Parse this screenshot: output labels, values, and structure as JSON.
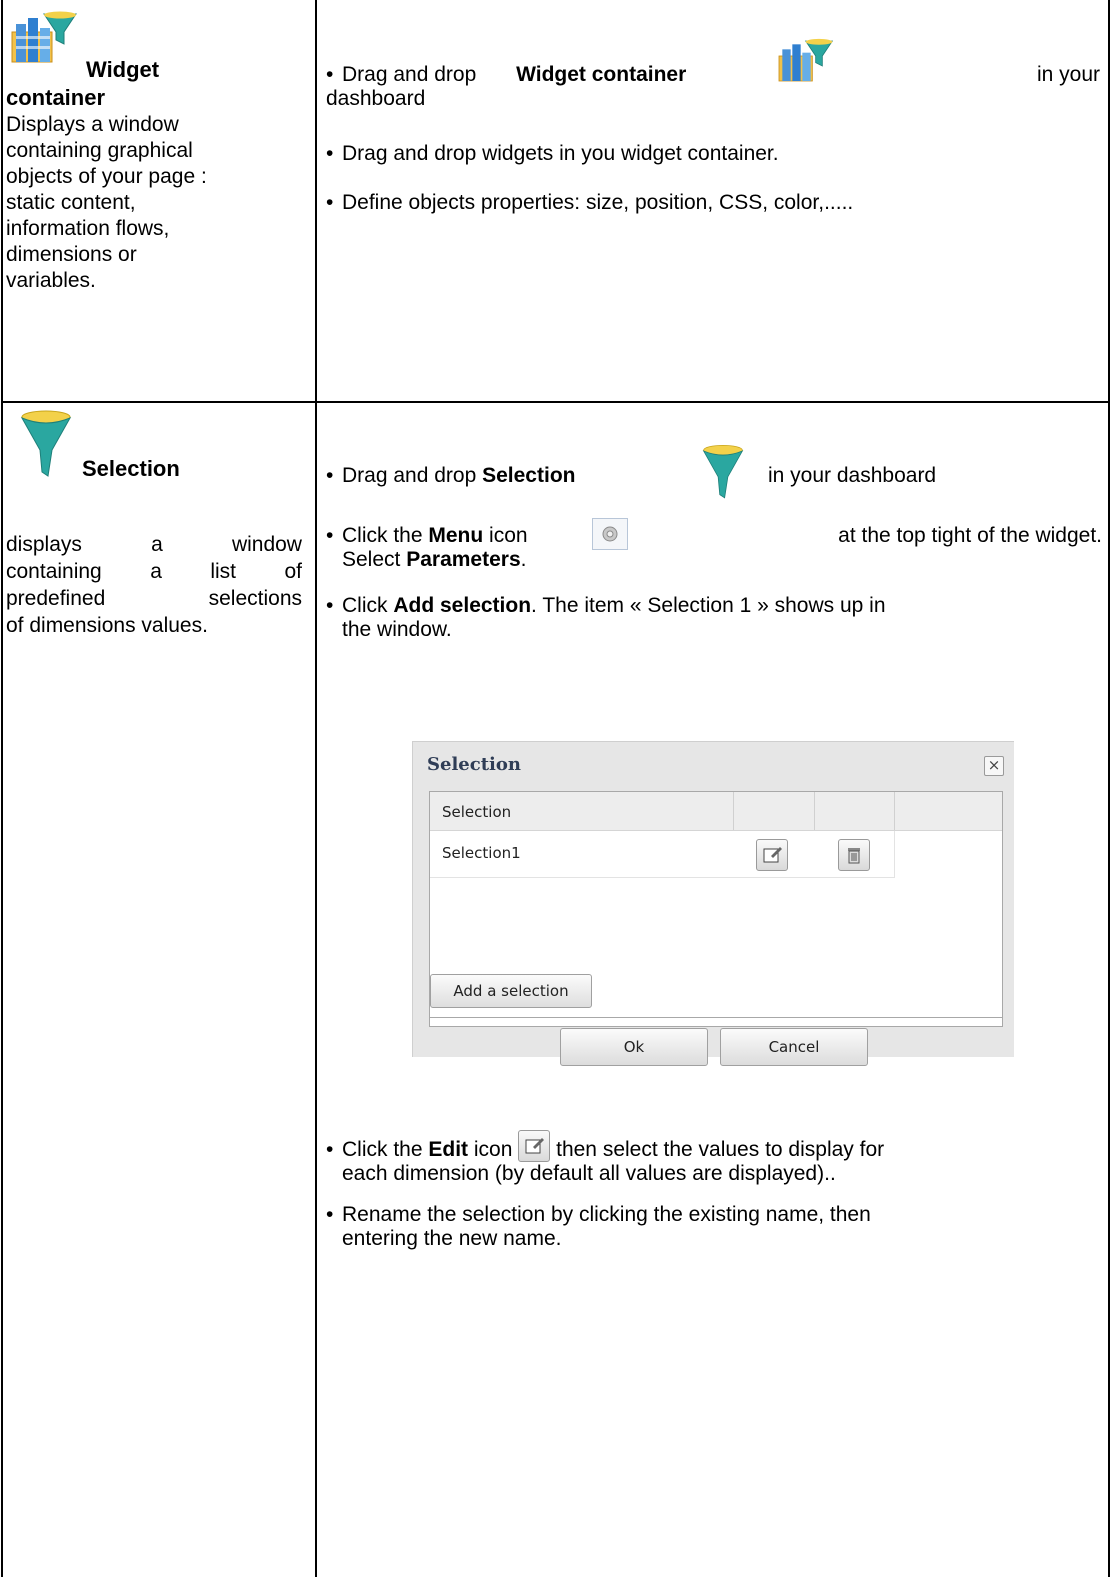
{
  "rows": [
    {
      "name": "Widget container",
      "description": "Displays a window containing graphical objects of your page : static content, information flows, dimensions or variables.",
      "desc_lines": [
        "Displays a window",
        "containing graphical",
        "objects of your page :",
        "static content,",
        "information flows,",
        "dimensions or",
        "variables."
      ],
      "steps": {
        "s1_pre": "Drag and drop",
        "s1_bold": "Widget container",
        "s1_post": "in your",
        "s1_post2": "dashboard",
        "s2": "Drag and drop widgets in you widget container.",
        "s3": "Define objects properties: size, position, CSS, color,....."
      }
    },
    {
      "name": "Selection",
      "desc_lines": [
        {
          "words": [
            "displays",
            "a",
            "window"
          ]
        },
        {
          "words": [
            "containing",
            "a",
            "list",
            "of"
          ]
        },
        {
          "words": [
            "predefined",
            "selections"
          ]
        },
        {
          "words": [
            "of dimensions values."
          ]
        }
      ],
      "steps": {
        "s1_pre": "Drag and drop",
        "s1_bold": "Selection",
        "s1_post": "in your dashboard",
        "s2_pre": "Click the",
        "s2_bold": "Menu",
        "s2_mid": "icon",
        "s2_post": "at the top tight of the widget.",
        "s2_l2_pre": "Select",
        "s2_l2_bold": "Parameters",
        "s2_l2_post": ".",
        "s3_pre": "Click",
        "s3_bold": "Add selection",
        "s3_post": ". The item « Selection 1 » shows up in",
        "s3_l2": "the window.",
        "s4_pre": "Click the",
        "s4_bold": "Edit",
        "s4_mid": "icon",
        "s4_post": "then select the values to display for",
        "s4_l2": "each dimension (by default all values are displayed)..",
        "s5": "Rename the selection by clicking the existing name, then",
        "s5_l2": "entering the new name."
      }
    }
  ],
  "bullet": "•",
  "dialog": {
    "title": "Selection",
    "close": "×",
    "columns": [
      "Selection",
      "",
      "",
      ""
    ],
    "items": [
      "Selection1"
    ],
    "add_button": "Add a selection",
    "ok_button": "Ok",
    "cancel_button": "Cancel"
  },
  "colors": {
    "funnel": "#2aa7a0",
    "table_border": "#000000",
    "dialog_title": "#2f3d56"
  },
  "icons": [
    "widget-container-icon",
    "funnel-icon",
    "gear-icon",
    "edit-icon",
    "trash-icon"
  ]
}
